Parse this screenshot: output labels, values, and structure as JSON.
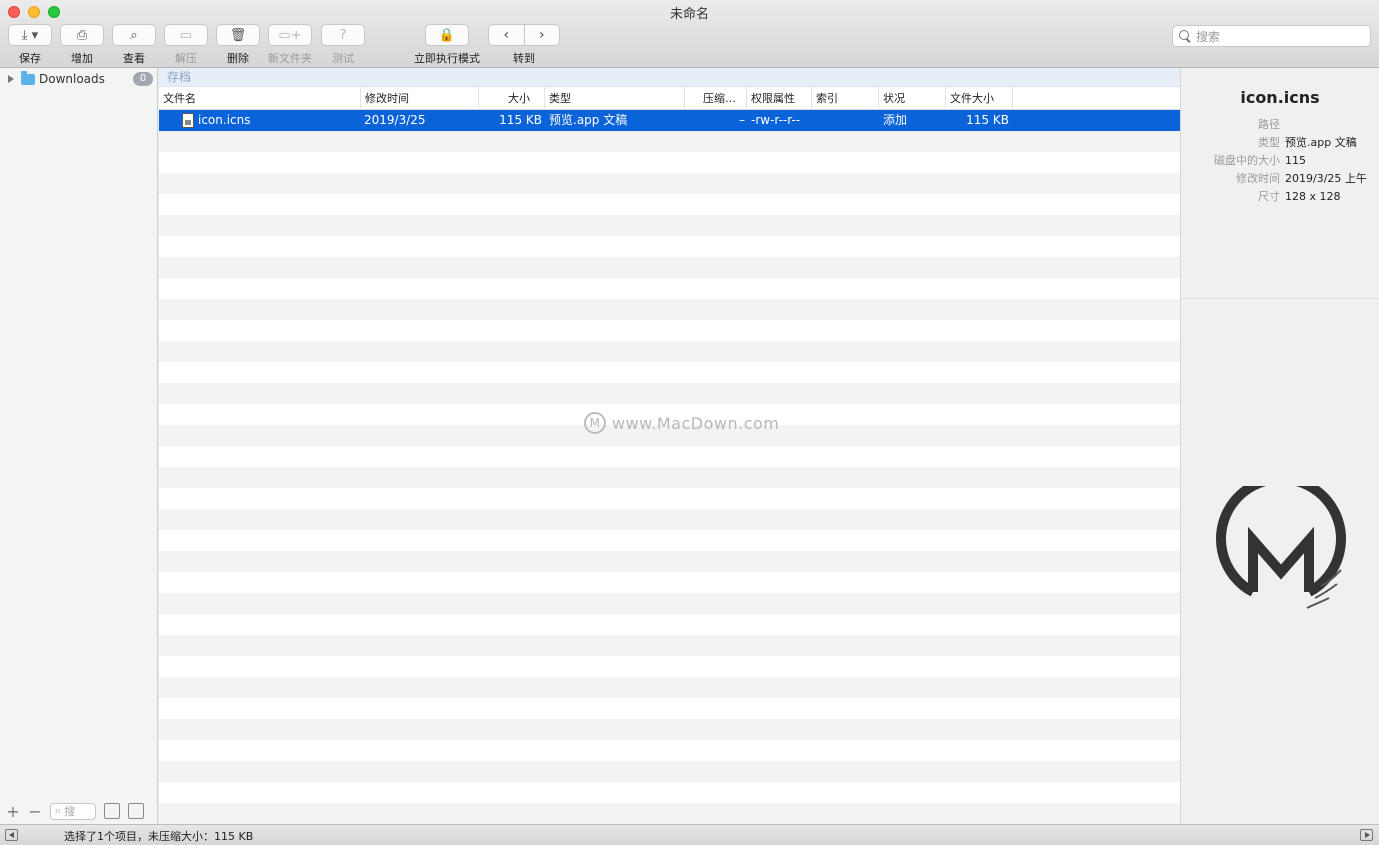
{
  "window": {
    "title": "未命名"
  },
  "toolbar": {
    "save": {
      "label": "保存",
      "icon": "save-icon"
    },
    "add": {
      "label": "增加",
      "icon": "add-file-icon"
    },
    "view": {
      "label": "查看",
      "icon": "magnifier-icon"
    },
    "extract": {
      "label": "解压",
      "icon": "extract-icon"
    },
    "delete": {
      "label": "删除",
      "icon": "trash-icon"
    },
    "new_folder": {
      "label": "新文件夹",
      "icon": "new-folder-icon"
    },
    "test": {
      "label": "测试",
      "icon": "test-icon"
    },
    "instant_mode": {
      "label": "立即执行模式",
      "icon": "lock-icon"
    },
    "goto": {
      "label": "转到"
    }
  },
  "search": {
    "placeholder": "搜索"
  },
  "sidebar": {
    "items": [
      {
        "label": "Downloads",
        "count": "0"
      }
    ],
    "search_placeholder": "搜"
  },
  "archive_bar": {
    "label": "存档"
  },
  "table": {
    "columns": [
      "文件名",
      "修改时间",
      "大小",
      "类型",
      "压缩…",
      "权限属性",
      "索引",
      "状况",
      "文件大小"
    ],
    "rows": [
      {
        "name": "icon.icns",
        "modified": "2019/3/25",
        "size": "115 KB",
        "type": "预览.app 文稿",
        "compressed": "–",
        "permissions": "-rw-r--r--",
        "index": "",
        "status": "添加",
        "file_size": "115 KB",
        "selected": true
      }
    ]
  },
  "watermark": {
    "text": "www.MacDown.com"
  },
  "info": {
    "name": "icon.icns",
    "props": [
      {
        "key": "路径",
        "value": ""
      },
      {
        "key": "类型",
        "value": "预览.app 文稿"
      },
      {
        "key": "磁盘中的大小",
        "value": "115"
      },
      {
        "key": "修改时间",
        "value": "2019/3/25 上午"
      },
      {
        "key": "尺寸",
        "value": "128 x 128"
      }
    ]
  },
  "status": {
    "text": "选择了1个项目，未压缩大小：115 KB"
  },
  "colors": {
    "selection": "#0a63d9",
    "accent": "#5bb2ea"
  }
}
